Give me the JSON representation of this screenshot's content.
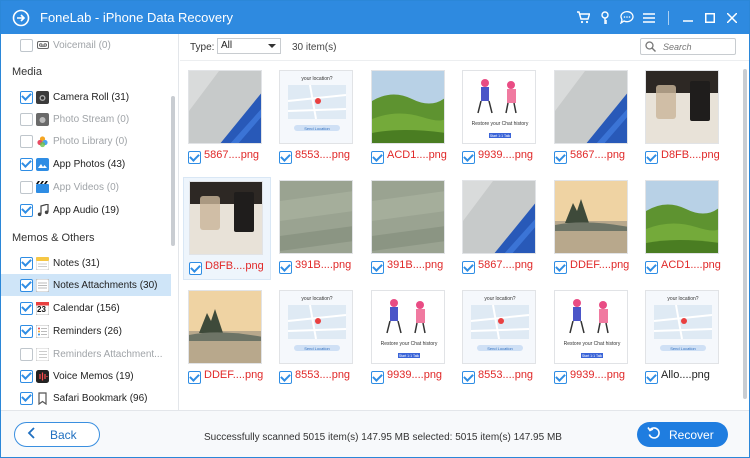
{
  "window": {
    "title": "FoneLab - iPhone Data Recovery"
  },
  "sidebar": {
    "items_top": [
      {
        "label": "Voicemail (0)",
        "checked": false,
        "disabled": true,
        "icon": "voicemail-icon"
      }
    ],
    "media_title": "Media",
    "media": [
      {
        "label": "Camera Roll (31)",
        "checked": true,
        "disabled": false,
        "icon": "camera-icon"
      },
      {
        "label": "Photo Stream (0)",
        "checked": false,
        "disabled": true,
        "icon": "photo-stream-icon"
      },
      {
        "label": "Photo Library (0)",
        "checked": false,
        "disabled": true,
        "icon": "photo-library-icon"
      },
      {
        "label": "App Photos (43)",
        "checked": true,
        "disabled": false,
        "icon": "app-photos-icon"
      },
      {
        "label": "App Videos (0)",
        "checked": false,
        "disabled": true,
        "icon": "app-videos-icon"
      },
      {
        "label": "App Audio (19)",
        "checked": true,
        "disabled": false,
        "icon": "music-note-icon"
      }
    ],
    "memos_title": "Memos & Others",
    "memos": [
      {
        "label": "Notes (31)",
        "checked": true,
        "disabled": false,
        "icon": "notes-icon"
      },
      {
        "label": "Notes Attachments (30)",
        "checked": true,
        "disabled": false,
        "icon": "notes-attachments-icon",
        "selected": true
      },
      {
        "label": "Calendar (156)",
        "checked": true,
        "disabled": false,
        "icon": "calendar-icon"
      },
      {
        "label": "Reminders (26)",
        "checked": true,
        "disabled": false,
        "icon": "reminders-icon"
      },
      {
        "label": "Reminders Attachment...",
        "checked": false,
        "disabled": true,
        "icon": "reminders-attachment-icon"
      },
      {
        "label": "Voice Memos (19)",
        "checked": true,
        "disabled": false,
        "icon": "voice-memos-icon"
      },
      {
        "label": "Safari Bookmark (96)",
        "checked": true,
        "disabled": false,
        "icon": "safari-bookmark-icon"
      }
    ],
    "calendar_badge": "23"
  },
  "toolbar": {
    "type_label": "Type:",
    "type_value": "All",
    "count": "30 item(s)",
    "search_placeholder": "Search"
  },
  "grid": [
    {
      "name": "5867....png",
      "thumb": "glass",
      "checked": true
    },
    {
      "name": "8553....png",
      "thumb": "map",
      "checked": true
    },
    {
      "name": "ACD1....png",
      "thumb": "hills",
      "checked": true
    },
    {
      "name": "9939....png",
      "thumb": "people",
      "checked": true
    },
    {
      "name": "5867....png",
      "thumb": "glass",
      "checked": true
    },
    {
      "name": "D8FB....png",
      "thumb": "cup",
      "checked": true
    },
    {
      "name": "D8FB....png",
      "thumb": "cup",
      "checked": true,
      "selected": true
    },
    {
      "name": "391B....png",
      "thumb": "green",
      "checked": true
    },
    {
      "name": "391B....png",
      "thumb": "green",
      "checked": true
    },
    {
      "name": "5867....png",
      "thumb": "glass",
      "checked": true
    },
    {
      "name": "DDEF....png",
      "thumb": "lake",
      "checked": true
    },
    {
      "name": "ACD1....png",
      "thumb": "hills",
      "checked": true
    },
    {
      "name": "DDEF....png",
      "thumb": "lake",
      "checked": true
    },
    {
      "name": "8553....png",
      "thumb": "map",
      "checked": true
    },
    {
      "name": "9939....png",
      "thumb": "people",
      "checked": true
    },
    {
      "name": "8553....png",
      "thumb": "map",
      "checked": true
    },
    {
      "name": "9939....png",
      "thumb": "people",
      "checked": true
    },
    {
      "name": "Allo....png",
      "thumb": "map",
      "checked": true,
      "black": true
    }
  ],
  "thumb_text": {
    "map_title": "your location?",
    "people_title": "Restore your Chat history",
    "people_button": "Start 1:1 Talk",
    "map_button": "Send Location"
  },
  "bottom": {
    "back_label": "Back",
    "status": "Successfully scanned 5015 item(s) 147.95 MB   selected: 5015 item(s) 147.95 MB",
    "recover_label": "Recover"
  },
  "colors": {
    "titlebar": "#2e8ae0",
    "accent": "#1f7de0",
    "filename": "#e02828",
    "selected_row": "#cfe5f8"
  }
}
